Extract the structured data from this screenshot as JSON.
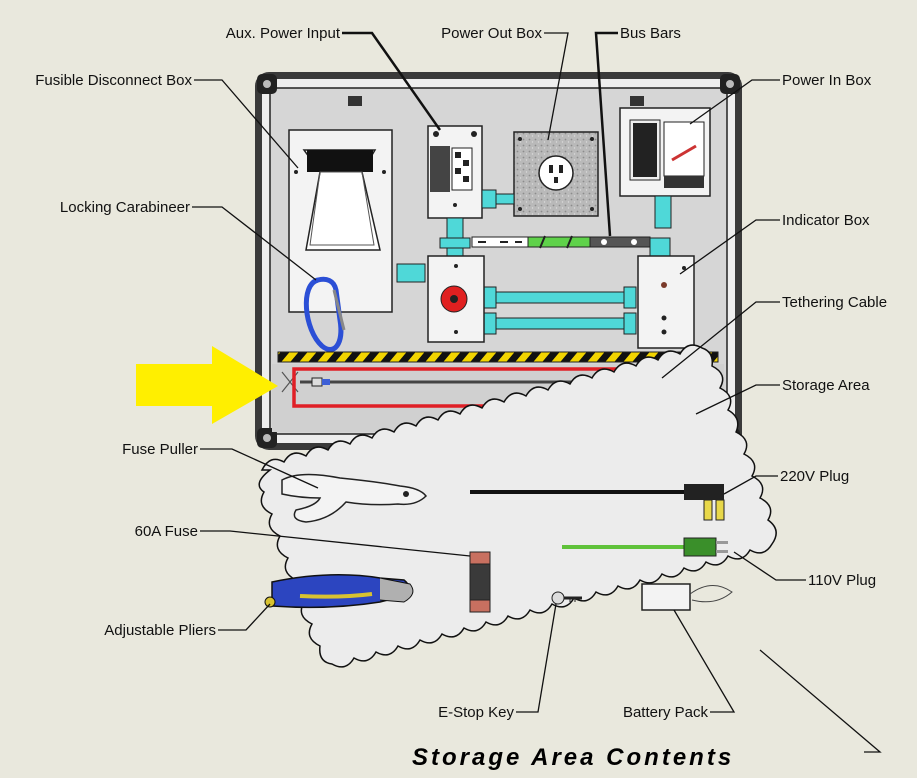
{
  "diagram": {
    "title": "Storage Area Contents",
    "callouts": {
      "aux_power_input": "Aux. Power Input",
      "power_out_box": "Power Out Box",
      "bus_bars": "Bus Bars",
      "fusible_disconnect_box": "Fusible Disconnect Box",
      "power_in_box": "Power In Box",
      "locking_carabineer": "Locking Carabineer",
      "indicator_box": "Indicator Box",
      "tethering_cable": "Tethering Cable",
      "storage_area": "Storage Area",
      "fuse_puller": "Fuse Puller",
      "plug_220v": "220V Plug",
      "fuse_60a": "60A Fuse",
      "plug_110v": "110V Plug",
      "adjustable_pliers": "Adjustable Pliers",
      "estop_key": "E-Stop Key",
      "battery_pack": "Battery Pack"
    },
    "colors": {
      "background": "#e9e8dd",
      "panel": "#d6d6d6",
      "conduit": "#4fd8d8",
      "highlight_box": "#e01f26",
      "arrow": "#ffef00",
      "hazard_stripe": "#f2d400",
      "carabiner": "#2b4fd6",
      "cord_110v": "#5fc23a",
      "cord_220v": "#111111"
    }
  }
}
